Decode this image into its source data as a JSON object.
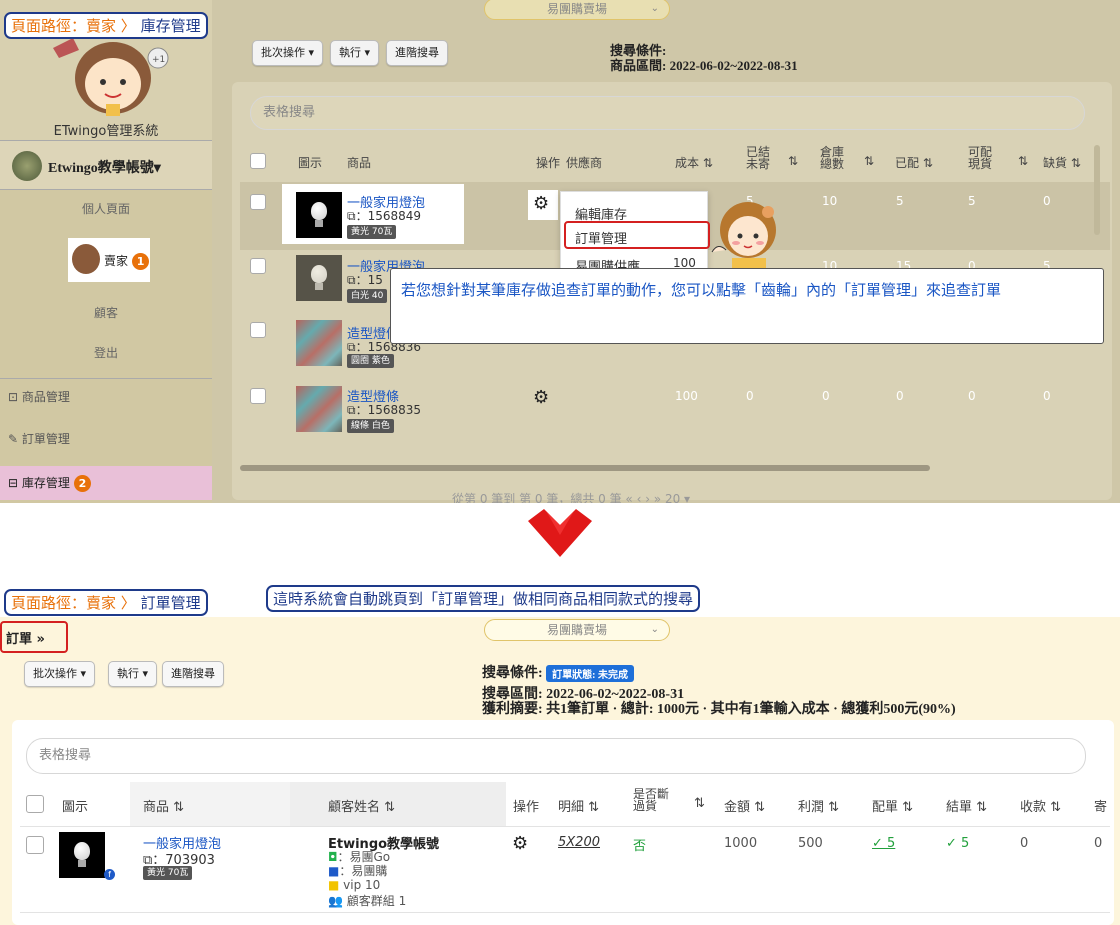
{
  "top": {
    "breadcrumb": {
      "prefix": "頁面路徑：賣家",
      "sep": "〉",
      "current": "庫存管理"
    },
    "market_select": "易團購賣場",
    "toolbar": {
      "batch": "批次操作 ▾",
      "execute": "執行 ▾",
      "advanced": "進階搜尋"
    },
    "search_conditions": {
      "label": "搜尋條件:",
      "range": "商品區間: 2022-06-02~2022-08-31"
    },
    "table_search_placeholder": "表格搜尋",
    "sidebar": {
      "system_name": "ETwingo管理系統",
      "account": "Etwingo教學帳號▾",
      "items": [
        "個人頁面",
        "賣家",
        "顧客",
        "登出"
      ],
      "nav": [
        "商品管理",
        "訂單管理",
        "庫存管理"
      ],
      "seller_badge": "1",
      "inventory_badge": "2"
    },
    "columns": [
      "圖示",
      "商品",
      "操作",
      "供應商",
      "成本 ⇅",
      "已結\n未寄",
      "⇅",
      "倉庫\n總數",
      "⇅",
      "已配 ⇅",
      "可配\n現貨",
      "⇅",
      "缺貨 ⇅"
    ],
    "rows": [
      {
        "name": "一般家用燈泡",
        "id": "⧉：1568849",
        "tag": "黃光 70瓦",
        "cost": "",
        "vals": [
          "5",
          "10",
          "5",
          "5",
          "0"
        ]
      },
      {
        "name": "一般家用燈泡",
        "id": "⧉：15",
        "tag": "白光 40",
        "cost": "100",
        "vals": [
          "5",
          "10",
          "15",
          "0",
          "5"
        ]
      },
      {
        "name": "造型燈條",
        "id": "⧉：1568836",
        "tag": "圓圈 紫色",
        "cost": "",
        "vals": []
      },
      {
        "name": "造型燈條",
        "id": "⧉：1568835",
        "tag": "線條 白色",
        "cost": "100",
        "vals": [
          "0",
          "0",
          "0",
          "0",
          "0"
        ]
      }
    ],
    "gear_menu": [
      "編輯庫存",
      "訂單管理",
      "易團購供應"
    ],
    "callout": "若您想針對某筆庫存做追查訂單的動作，您可以點擊「齒輪」內的「訂單管理」來追查訂單",
    "pagination": "從第 0 筆到 第 0 筆，總共 0 筆     «    ‹     ›    »     20 ▾"
  },
  "bottom": {
    "breadcrumb": {
      "prefix": "頁面路徑：賣家",
      "sep": "〉",
      "current": "訂單管理"
    },
    "note": "這時系統會自動跳頁到「訂單管理」做相同商品相同款式的搜尋",
    "tab": "訂單 »",
    "market_select": "易團購賣場",
    "toolbar": {
      "batch": "批次操作 ▾",
      "execute": "執行 ▾",
      "advanced": "進階搜尋"
    },
    "search_conditions": {
      "label": "搜尋條件:",
      "status_tag": "訂單狀態: 未完成",
      "range": "搜尋區間: 2022-06-02~2022-08-31",
      "profit": "獲利摘要: 共1筆訂單 · 總計: 1000元 · 其中有1筆輸入成本 · 總獲利500元(90%)"
    },
    "table_search_placeholder": "表格搜尋",
    "columns": [
      "圖示",
      "商品 ⇅",
      "顧客姓名 ⇅",
      "操作",
      "明細 ⇅",
      "是否斷\n過貨",
      "⇅",
      "金額 ⇅",
      "利潤 ⇅",
      "配單 ⇅",
      "結單 ⇅",
      "收款 ⇅",
      "寄"
    ],
    "row": {
      "product": "一般家用燈泡",
      "product_id": "⧉：703903",
      "tag": "黃光 70瓦",
      "customer": "Etwingo教學帳號",
      "line": "：易團Go",
      "fb": "：易團購",
      "vip": "vip 10",
      "group": "顧客群組 1",
      "detail": "5X200",
      "out_of_stock": "否",
      "amount": "1000",
      "profit": "500",
      "assigned": "✓ 5",
      "closed": "✓ 5",
      "paid": "0",
      "ship": "0"
    }
  }
}
